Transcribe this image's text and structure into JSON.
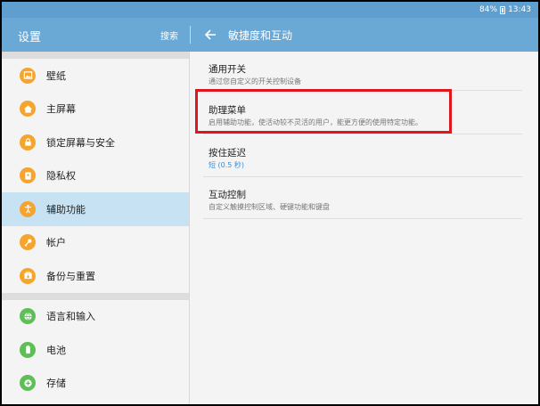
{
  "status": {
    "battery": "84%",
    "time": "13:43"
  },
  "appbar": {
    "title": "设置",
    "search": "搜索",
    "page_title": "敏捷度和互动"
  },
  "sidebar": {
    "groups": [
      [
        {
          "label": "壁纸",
          "icon": "wallpaper-icon",
          "color": "#f5a52d"
        },
        {
          "label": "主屏幕",
          "icon": "home-icon",
          "color": "#f5a52d"
        },
        {
          "label": "锁定屏幕与安全",
          "icon": "lock-icon",
          "color": "#f5a52d"
        },
        {
          "label": "隐私权",
          "icon": "privacy-icon",
          "color": "#f5a52d"
        },
        {
          "label": "辅助功能",
          "icon": "accessibility-icon",
          "color": "#f5a52d",
          "active": true
        },
        {
          "label": "帐户",
          "icon": "key-icon",
          "color": "#f5a52d"
        },
        {
          "label": "备份与重置",
          "icon": "backup-icon",
          "color": "#f5a52d"
        }
      ],
      [
        {
          "label": "语言和输入",
          "icon": "language-icon",
          "color": "#5fbf56"
        },
        {
          "label": "电池",
          "icon": "battery-icon",
          "color": "#5fbf56"
        },
        {
          "label": "存储",
          "icon": "storage-icon",
          "color": "#5fbf56"
        }
      ]
    ]
  },
  "main": {
    "settings": [
      {
        "title": "通用开关",
        "subtitle": "通过您自定义的开关控制设备"
      },
      {
        "title": "助理菜单",
        "subtitle": "启用辅助功能，使活动较不灵活的用户，能更方便的使用特定功能。"
      },
      {
        "title": "按住延迟",
        "subtitle": "短 (0.5 秒)"
      },
      {
        "title": "互动控制",
        "subtitle": "自定义触摸控制区域、硬键功能和键盘"
      }
    ]
  },
  "colors": {
    "appbar": "#6aa8d6",
    "statusbar": "#5f9fcf",
    "active": "#c7e2f3",
    "highlight": "#e0161f",
    "orange": "#f5a52d",
    "green": "#5fbf56"
  }
}
